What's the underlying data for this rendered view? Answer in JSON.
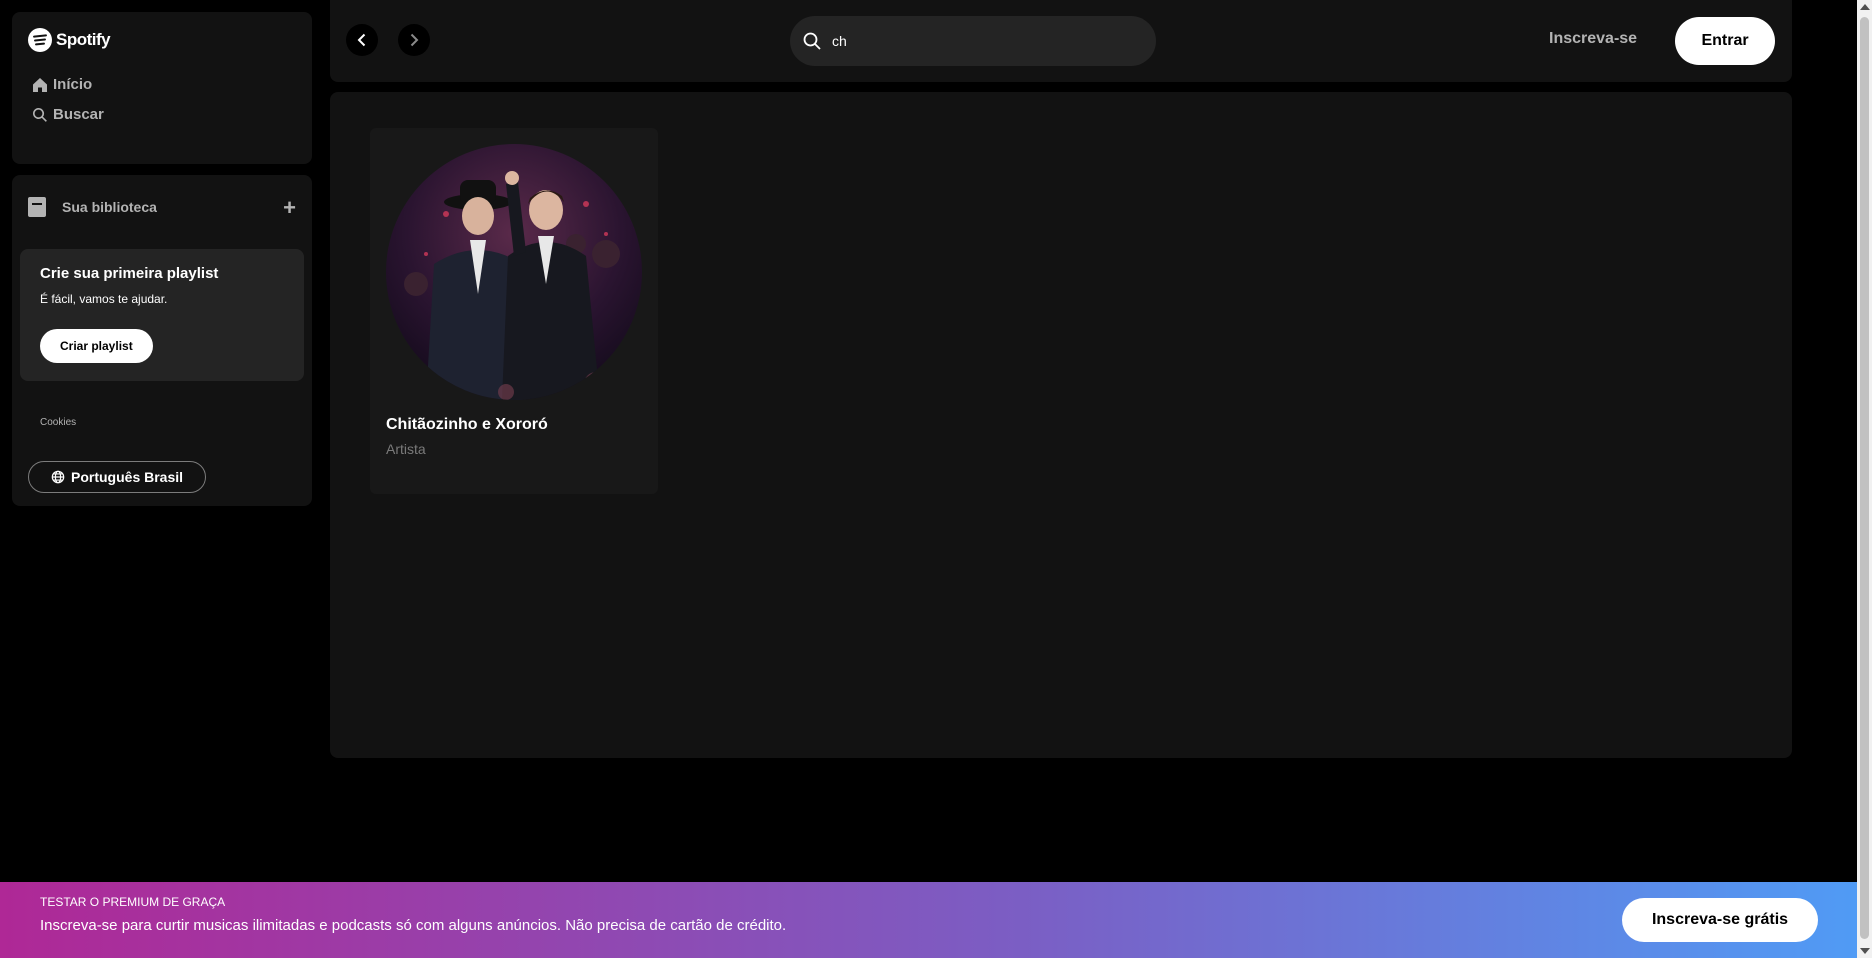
{
  "brand": {
    "name": "Spotify"
  },
  "nav": {
    "home_label": "Início",
    "search_label": "Buscar"
  },
  "library": {
    "title": "Sua biblioteca",
    "add_icon": "plus-icon",
    "promo": {
      "heading": "Crie sua primeira playlist",
      "text": "É fácil, vamos te ajudar.",
      "button": "Criar playlist"
    },
    "cookies_link": "Cookies",
    "language_button": "Português Brasil"
  },
  "topbar": {
    "back_icon": "chevron-left-icon",
    "forward_icon": "chevron-right-icon",
    "search_value": "ch",
    "signup_label": "Inscreva-se",
    "login_label": "Entrar"
  },
  "results": [
    {
      "name": "Chitãozinho e Xororó",
      "type": "Artista"
    }
  ],
  "banner": {
    "kicker": "TESTAR O PREMIUM DE GRAÇA",
    "message": "Inscreva-se para curtir musicas ilimitadas e podcasts só com alguns anúncios. Não precisa de cartão de crédito.",
    "button": "Inscreva-se grátis",
    "gradient_start": "#af2896",
    "gradient_end": "#509bf5"
  }
}
